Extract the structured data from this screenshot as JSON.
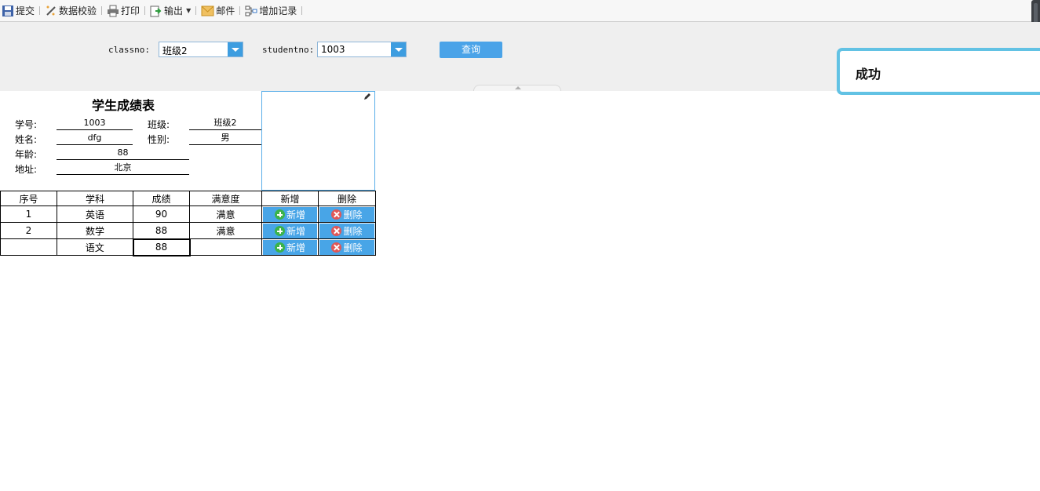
{
  "toolbar": {
    "submit": "提交",
    "validate": "数据校验",
    "print": "打印",
    "export": "输出",
    "mail": "邮件",
    "add_record": "增加记录"
  },
  "query": {
    "classno_label": "classno:",
    "classno_value": "班级2",
    "studentno_label": "studentno:",
    "studentno_value": "1003",
    "search_button": "查询"
  },
  "toast": {
    "message": "成功"
  },
  "report": {
    "title": "学生成绩表",
    "student_no_label": "学号:",
    "student_no": "1003",
    "class_label": "班级:",
    "class": "班级2",
    "name_label": "姓名:",
    "name": "dfg",
    "gender_label": "性别:",
    "gender": "男",
    "age_label": "年龄:",
    "age": "88",
    "address_label": "地址:",
    "address": "北京"
  },
  "grid": {
    "headers": [
      "序号",
      "学科",
      "成绩",
      "满意度",
      "新增",
      "删除"
    ],
    "rows": [
      {
        "no": "1",
        "subject": "英语",
        "score": "90",
        "satisfaction": "满意"
      },
      {
        "no": "2",
        "subject": "数学",
        "score": "88",
        "satisfaction": "满意"
      },
      {
        "no": "",
        "subject": "语文",
        "score": "88",
        "satisfaction": ""
      }
    ],
    "add_label": "新增",
    "delete_label": "删除"
  },
  "colors": {
    "accent": "#48a5e7",
    "toast_border": "#62c2e4",
    "add_icon": "#3bb34a",
    "delete_icon": "#e05757"
  }
}
